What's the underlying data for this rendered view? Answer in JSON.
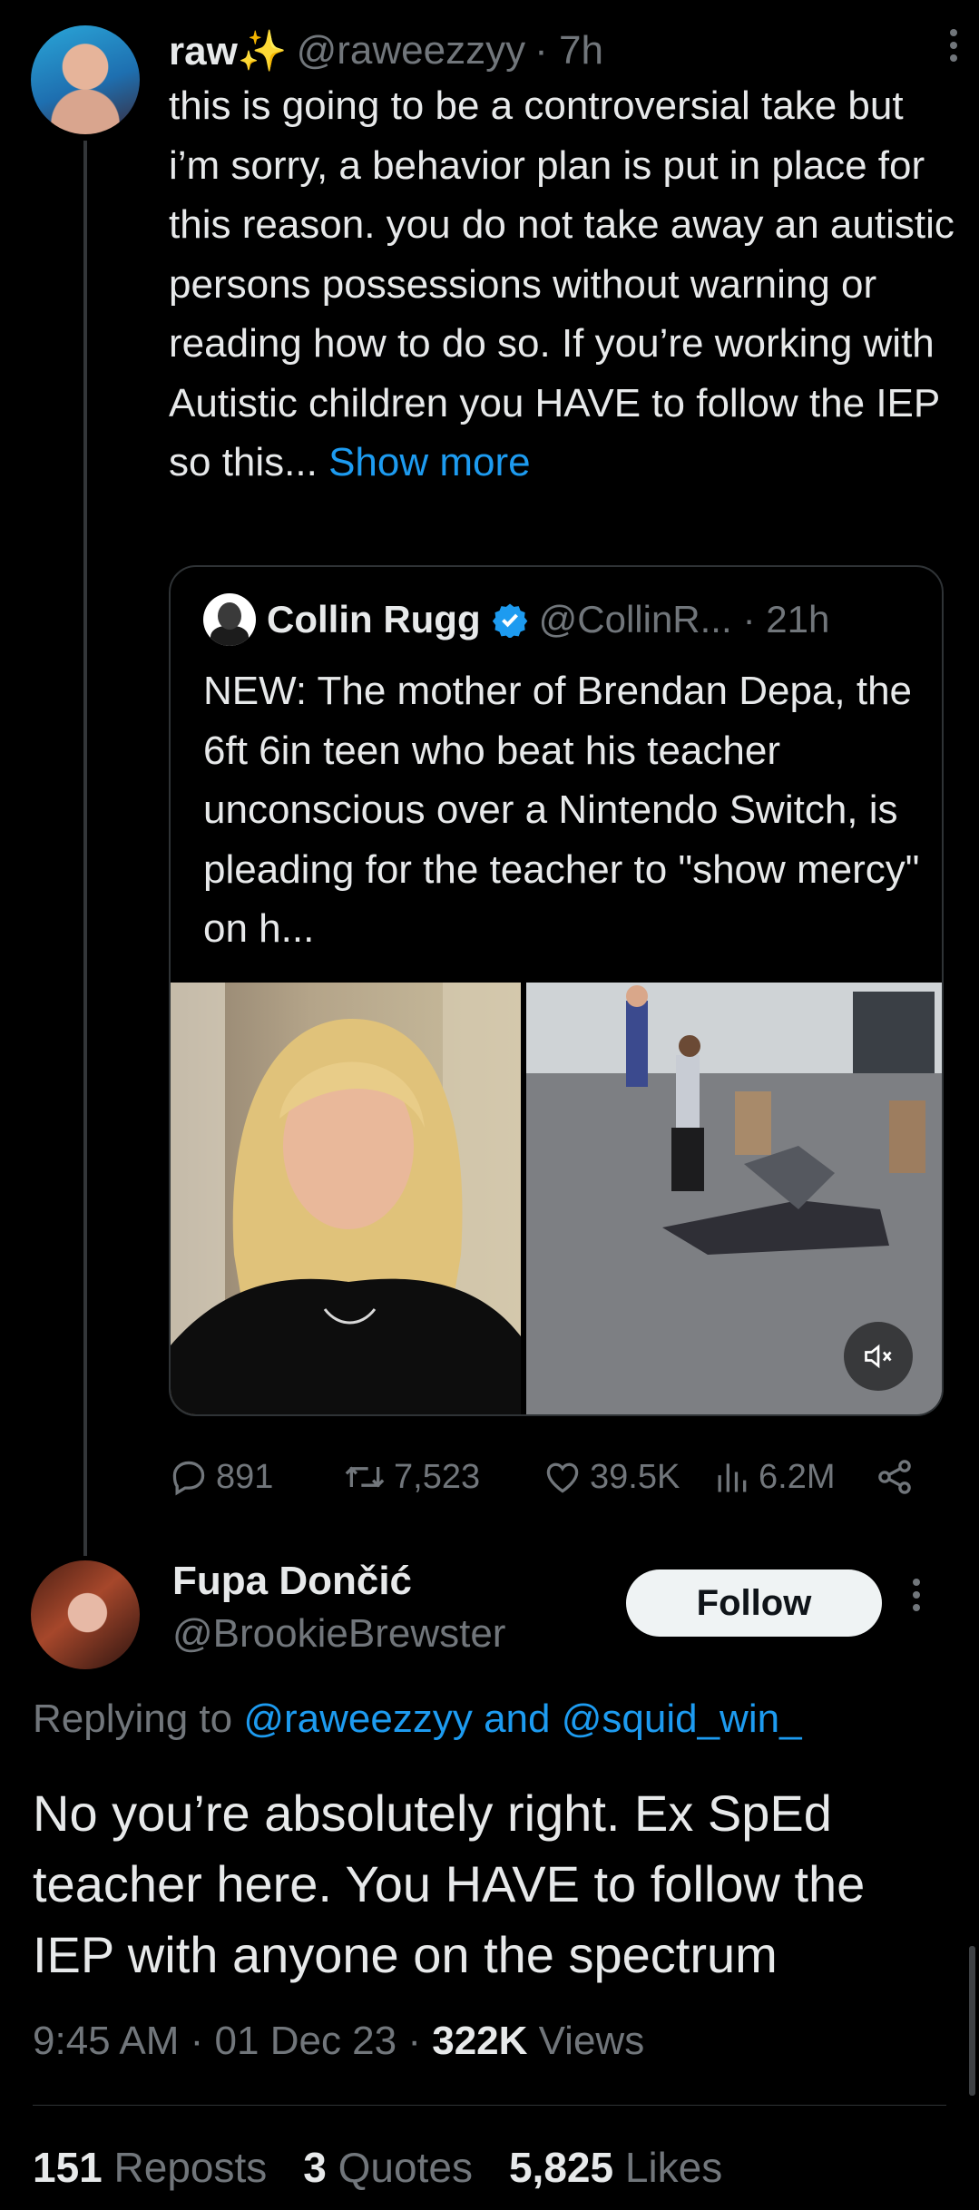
{
  "tweet": {
    "name": "raw✨",
    "handle": "@raweezzyy",
    "time": "· 7h",
    "text": "this is going to be a controversial take but i’m sorry, a behavior plan is put in place for this reason. you do not take away an autistic persons possessions without warning or reading how to do so. If you’re working with Autistic children you HAVE to follow the IEP so this...",
    "show_more": "Show more"
  },
  "quote": {
    "name": "Collin Rugg",
    "handle": "@CollinR...",
    "time": "· 21h",
    "text": "NEW: The mother of Brendan Depa, the 6ft 6in teen who beat his teacher unconscious over a Nintendo Switch, is pleading for the teacher to \"show mercy\" on h..."
  },
  "actions": {
    "replies": "891",
    "reposts": "7,523",
    "likes": "39.5K",
    "views": "6.2M"
  },
  "reply": {
    "name": "Fupa Dončić",
    "handle": "@BrookieBrewster",
    "follow_label": "Follow",
    "replying_prefix": "Replying to ",
    "replying_to": "@raweezzyy and @squid_win_",
    "text": "No you’re absolutely right. Ex SpEd teacher here. You HAVE to follow the IEP with anyone on the spectrum",
    "time": "9:45 AM · 01 Dec 23 · ",
    "views_count": "322K",
    "views_label": " Views",
    "reposts_count": "151",
    "reposts_label": " Reposts",
    "quotes_count": "3",
    "quotes_label": " Quotes",
    "likes_count": "5,825",
    "likes_label": " Likes"
  },
  "icons": {
    "more": "more-vertical-icon",
    "verified": "verified-badge-icon",
    "mute": "volume-mute-icon",
    "reply": "reply-icon",
    "repost": "repost-icon",
    "like": "heart-icon",
    "views": "views-chart-icon",
    "share": "share-icon"
  },
  "colors": {
    "background": "#000000",
    "text": "#e7e9ea",
    "muted": "#71767b",
    "accent": "#1d9bf0"
  }
}
